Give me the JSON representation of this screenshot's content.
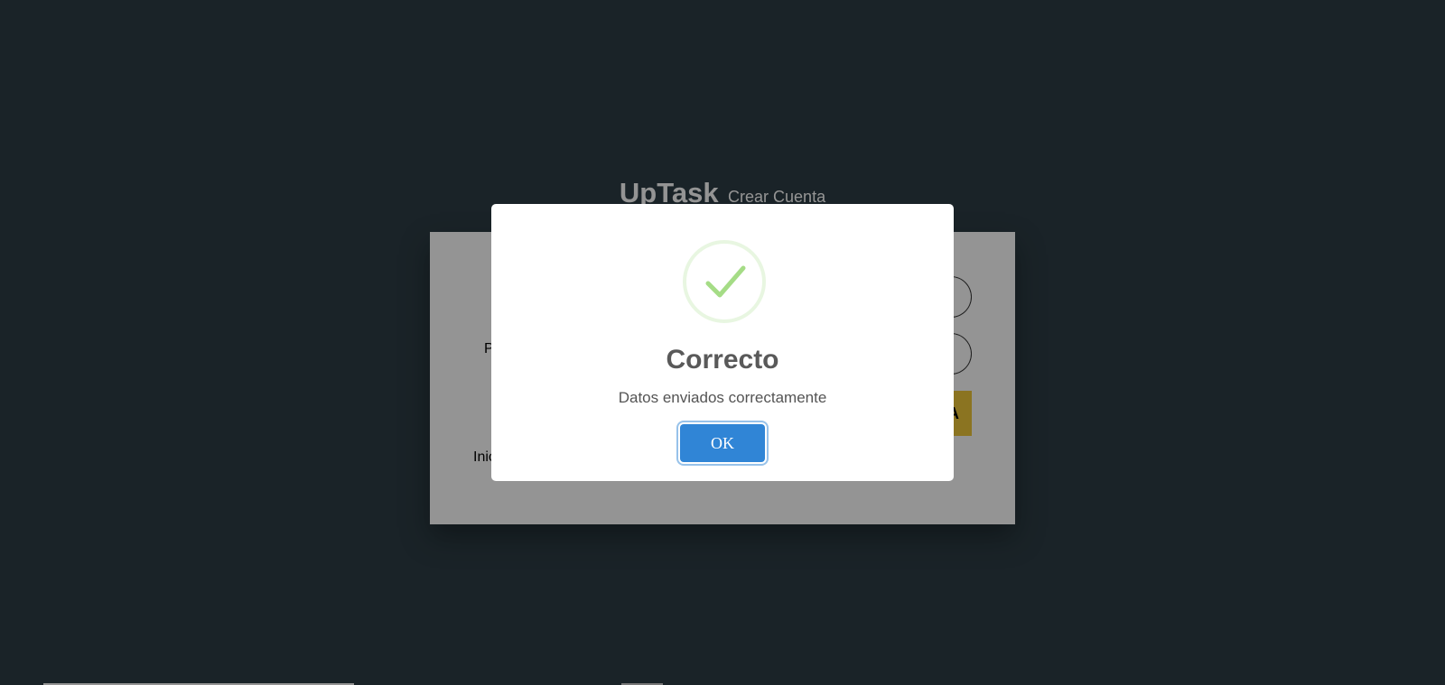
{
  "app": {
    "brand_name": "UpTask",
    "brand_subtitle": "Crear Cuenta"
  },
  "background_form": {
    "label_password_partial": "P",
    "submit_partial": "A",
    "login_link_partial": "Inic"
  },
  "modal": {
    "icon": "success-checkmark-icon",
    "title": "Correcto",
    "text": "Datos enviados correctamente",
    "ok_label": "OK",
    "colors": {
      "confirm_button": "#3085d6",
      "success_check": "#a5dc86"
    }
  }
}
